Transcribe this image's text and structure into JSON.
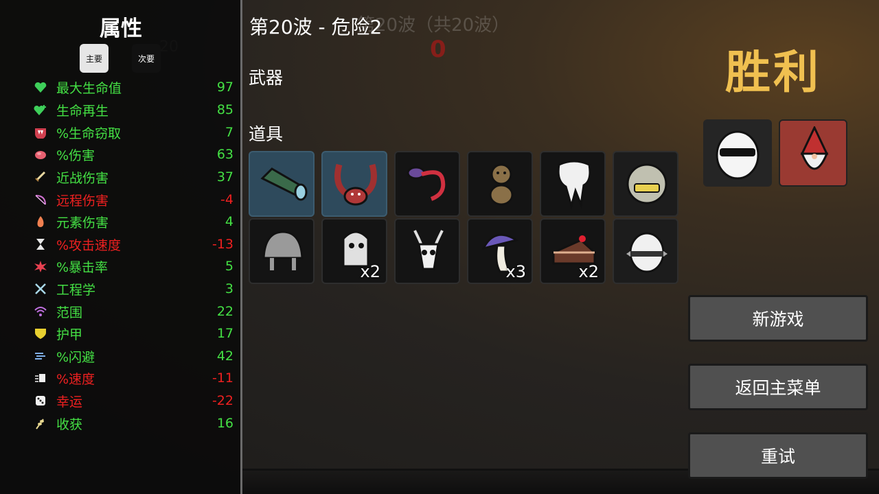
{
  "background": {
    "ghost_wave": "第20波（共20波）",
    "ghost_counter": "0",
    "ghost_number": "20"
  },
  "stats_panel": {
    "title": "属性",
    "tabs": [
      {
        "label": "主要",
        "selected": true
      },
      {
        "label": "次要",
        "selected": false
      }
    ],
    "stats": [
      {
        "name": "最大生命值",
        "value": "97",
        "color": "#44e044",
        "icon": "heart-icon"
      },
      {
        "name": "生命再生",
        "value": "85",
        "color": "#44e044",
        "icon": "regen-heart-icon"
      },
      {
        "name": "%生命窃取",
        "value": "7",
        "color": "#44e044",
        "icon": "fangs-icon"
      },
      {
        "name": "%伤害",
        "value": "63",
        "color": "#44e044",
        "icon": "muscle-icon"
      },
      {
        "name": "近战伤害",
        "value": "37",
        "color": "#44e044",
        "icon": "sword-icon"
      },
      {
        "name": "远程伤害",
        "value": "-4",
        "color": "#ee2020",
        "icon": "bow-icon"
      },
      {
        "name": "元素伤害",
        "value": "4",
        "color": "#44e044",
        "icon": "flame-icon"
      },
      {
        "name": "%攻击速度",
        "value": "-13",
        "color": "#ee2020",
        "icon": "hourglass-icon"
      },
      {
        "name": "%暴击率",
        "value": "5",
        "color": "#44e044",
        "icon": "critical-icon"
      },
      {
        "name": "工程学",
        "value": "3",
        "color": "#44e044",
        "icon": "wrench-icon"
      },
      {
        "name": "范围",
        "value": "22",
        "color": "#44e044",
        "icon": "range-icon"
      },
      {
        "name": "护甲",
        "value": "17",
        "color": "#44e044",
        "icon": "shield-icon"
      },
      {
        "name": "%闪避",
        "value": "42",
        "color": "#44e044",
        "icon": "dodge-icon"
      },
      {
        "name": "%速度",
        "value": "-11",
        "color": "#ee2020",
        "icon": "speed-icon"
      },
      {
        "name": "幸运",
        "value": "-22",
        "color": "#ee2020",
        "icon": "dice-icon"
      },
      {
        "name": "收获",
        "value": "16",
        "color": "#44e044",
        "icon": "harvest-icon"
      }
    ]
  },
  "main": {
    "wave_title": "第20波 - 危险2",
    "weapons_label": "武器",
    "items_label": "道具",
    "items": [
      {
        "name": "spyglass-icon",
        "quantity": null,
        "rarity_color": "#2e4a5c"
      },
      {
        "name": "tentacle-crab-icon",
        "quantity": null,
        "rarity_color": "#2e4a5c"
      },
      {
        "name": "tongue-creature-icon",
        "quantity": null,
        "rarity_color": "#141414"
      },
      {
        "name": "monkey-icon",
        "quantity": null,
        "rarity_color": "#141414"
      },
      {
        "name": "tooth-icon",
        "quantity": null,
        "rarity_color": "#141414"
      },
      {
        "name": "metal-face-icon",
        "quantity": null,
        "rarity_color": "#1c1c1c"
      },
      {
        "name": "helmet-icon",
        "quantity": null,
        "rarity_color": "#141414"
      },
      {
        "name": "skull-robot-icon",
        "quantity": "x2",
        "rarity_color": "#141414"
      },
      {
        "name": "goat-skull-icon",
        "quantity": null,
        "rarity_color": "#141414"
      },
      {
        "name": "mushroom-icon",
        "quantity": "x3",
        "rarity_color": "#141414"
      },
      {
        "name": "cake-icon",
        "quantity": "x2",
        "rarity_color": "#141414"
      },
      {
        "name": "spiked-egg-icon",
        "quantity": null,
        "rarity_color": "#1c1c1c"
      }
    ]
  },
  "right": {
    "victory": "胜利",
    "character": "sunglasses-egg-icon",
    "difficulty": "gnome-icon",
    "buttons": {
      "new_game": "新游戏",
      "main_menu": "返回主菜单",
      "retry": "重试"
    }
  },
  "colors": {
    "victory": "#f0c050",
    "positive": "#44e044",
    "negative": "#ee2020",
    "uncommon_item": "#2e4a5c",
    "danger_slot": "#9a3a32"
  }
}
